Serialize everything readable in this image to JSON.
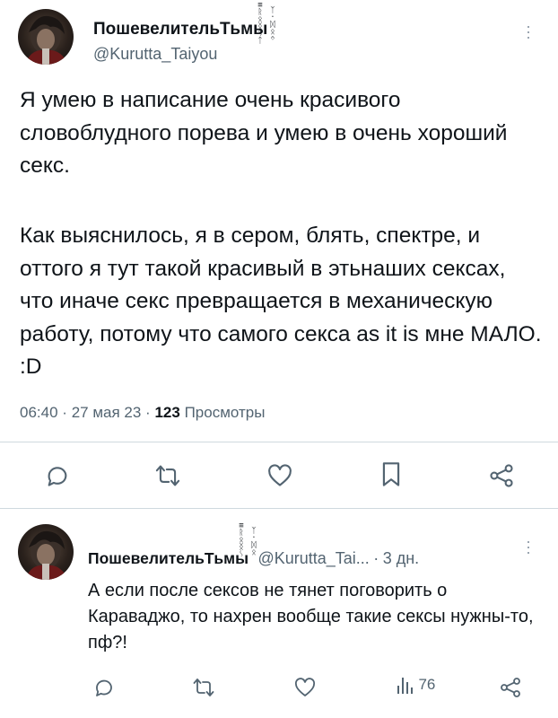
{
  "tweet": {
    "display_name": "Пошевелитель Тьмы",
    "name_part1": "Пошевелитель",
    "name_part2": "Тьмы",
    "handle": "@Kurutta_Taiyou",
    "paragraph1": "Я умею в написание очень красивого словоблудного порева и умею в очень хороший секс.",
    "paragraph2": "Как выяснилось, я в сером, блять, спектре, и оттого я тут такой красивый в этьнаших сексах, что иначе секс превращается в механическую работу, потому что самого секса as it is мне МАЛО. :D",
    "time": "06:40",
    "date": "27 мая 23",
    "views_count": "123",
    "views_label": "Просмотры",
    "sep": "·",
    "actions": [
      "comment-icon",
      "retweet-icon",
      "like-icon",
      "bookmark-icon",
      "share-icon"
    ]
  },
  "reply": {
    "name_part1": "Пошевелитель",
    "name_part2": "Тьмы",
    "handle": "@Kurutta_Tai...",
    "age": "3 дн.",
    "sep": "·",
    "text": "А если после сексов не тянет поговорить о Караваджо, то нахрен вообще такие сексы нужны-то, пф?!",
    "views": "76",
    "actions": [
      "comment-icon",
      "retweet-icon",
      "like-icon",
      "views-icon",
      "share-icon"
    ]
  },
  "colors": {
    "text": "#0f1419",
    "secondary": "#536471",
    "divider": "#cfd9de"
  }
}
